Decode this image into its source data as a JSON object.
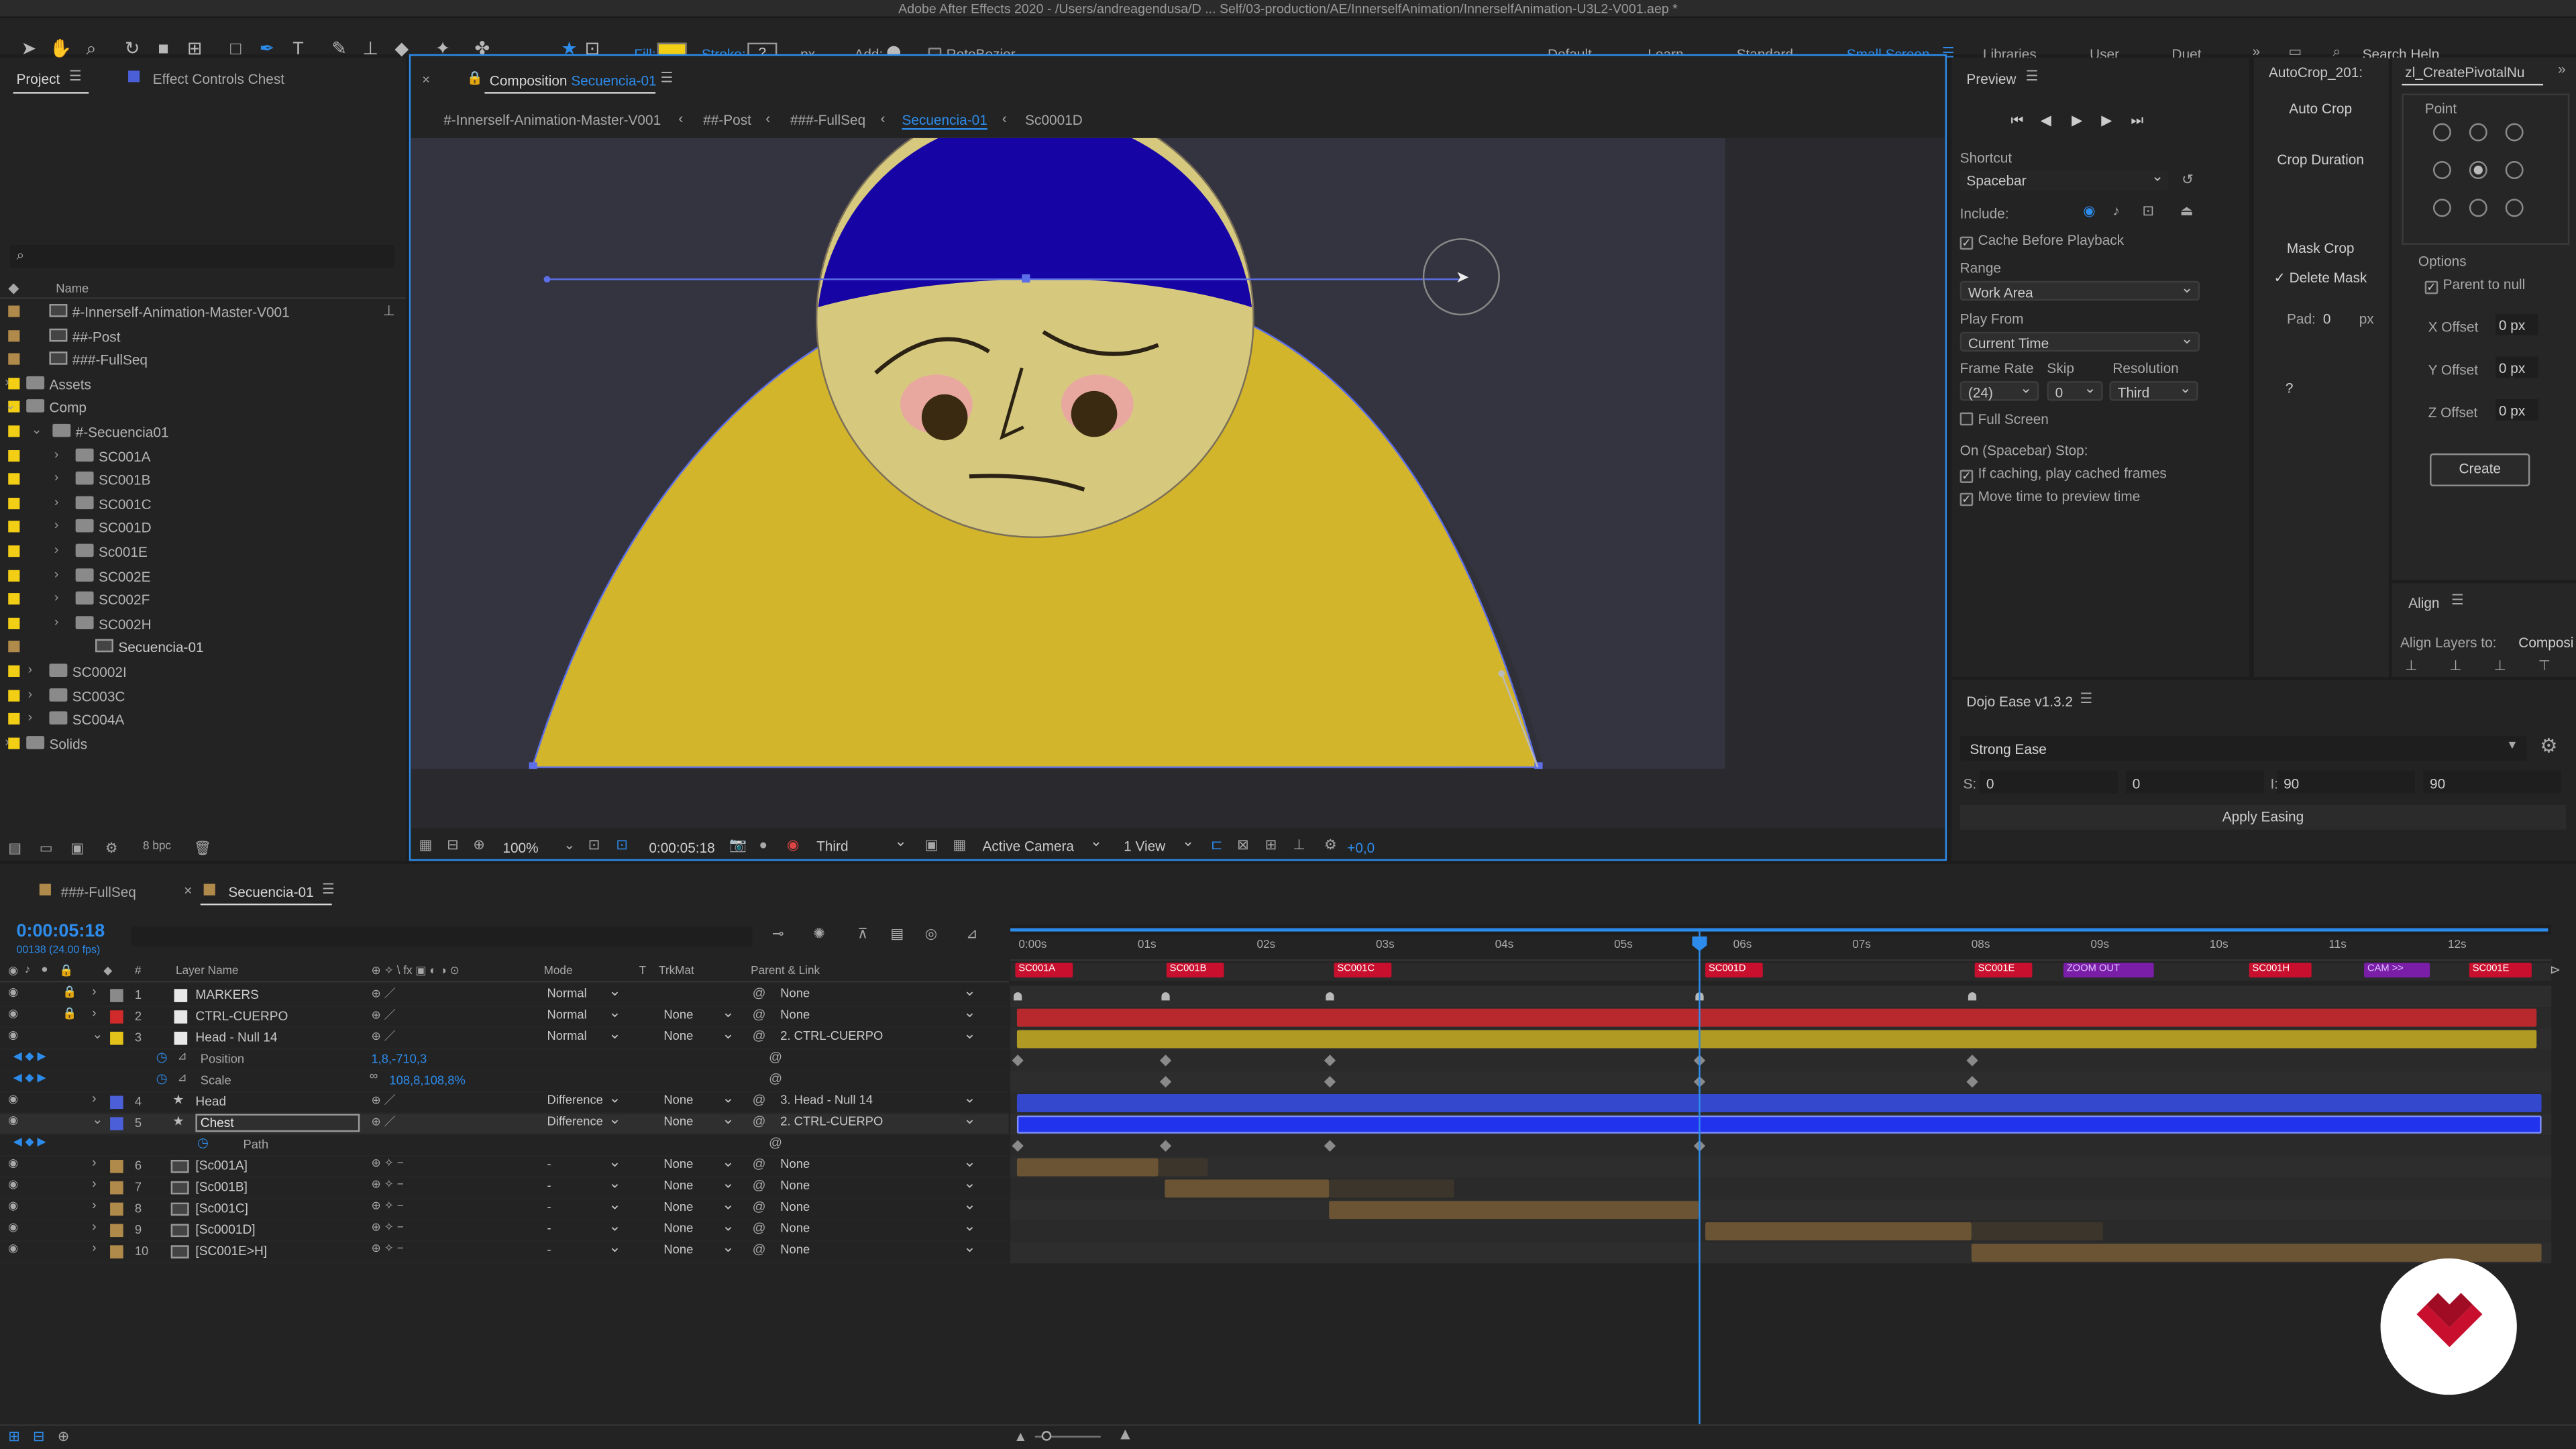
{
  "app": {
    "title": "Adobe After Effects 2020 - /Users/andreagendusa/D ... Self/03-production/AE/InnerselfAnimation/InnerselfAnimation-U3L2-V001.aep *"
  },
  "toolbar": {
    "fill_label": "Fill:",
    "stroke_label": "Stroke:",
    "stroke_value": "?",
    "px_label": "- px",
    "add_label": "Add:",
    "rotobezier_label": "RotoBezier",
    "fill_color": "#f2cf15"
  },
  "workspaces": [
    "Default",
    "Learn",
    "Standard",
    "Small Screen",
    "Libraries",
    "User",
    "Duet"
  ],
  "search": {
    "placeholder": "Search Help"
  },
  "project": {
    "tab_label": "Project",
    "effect_tab_label": "Effect Controls Chest",
    "name_header": "Name",
    "bpc": "8 bpc",
    "items": [
      {
        "label": "#-Innerself-Animation-Master-V001",
        "color": "#b08a4a",
        "icon": "composition-icon"
      },
      {
        "label": "##-Post",
        "color": "#b08a4a",
        "icon": "composition-icon"
      },
      {
        "label": "###-FullSeq",
        "color": "#b08a4a",
        "icon": "composition-icon"
      },
      {
        "label": "Assets",
        "color": "#f2cf15",
        "icon": "folder-icon"
      },
      {
        "label": "Comp",
        "color": "#f2cf15",
        "icon": "folder-icon"
      },
      {
        "label": "#-Secuencia01",
        "color": "#f2cf15",
        "icon": "folder-icon"
      },
      {
        "label": "SC001A",
        "color": "#f2cf15",
        "icon": "folder-icon"
      },
      {
        "label": "SC001B",
        "color": "#f2cf15",
        "icon": "folder-icon"
      },
      {
        "label": "SC001C",
        "color": "#f2cf15",
        "icon": "folder-icon"
      },
      {
        "label": "SC001D",
        "color": "#f2cf15",
        "icon": "folder-icon"
      },
      {
        "label": "Sc001E",
        "color": "#f2cf15",
        "icon": "folder-icon"
      },
      {
        "label": "SC002E",
        "color": "#f2cf15",
        "icon": "folder-icon"
      },
      {
        "label": "SC002F",
        "color": "#f2cf15",
        "icon": "folder-icon"
      },
      {
        "label": "SC002H",
        "color": "#f2cf15",
        "icon": "folder-icon"
      },
      {
        "label": "Secuencia-01",
        "color": "#b08a4a",
        "icon": "composition-icon"
      },
      {
        "label": "SC0002I",
        "color": "#f2cf15",
        "icon": "folder-icon"
      },
      {
        "label": "SC003C",
        "color": "#f2cf15",
        "icon": "folder-icon"
      },
      {
        "label": "SC004A",
        "color": "#f2cf15",
        "icon": "folder-icon"
      },
      {
        "label": "Solids",
        "color": "#f2cf15",
        "icon": "folder-icon"
      }
    ]
  },
  "composition": {
    "tab_prefix": "Composition",
    "tab_name": "Secuencia-01",
    "breadcrumbs": [
      "#-Innerself-Animation-Master-V001",
      "##-Post",
      "###-FullSeq",
      "Secuencia-01",
      "Sc0001D"
    ],
    "zoom": "100%",
    "timecode": "0:00:05:18",
    "resolution": "Third",
    "camera": "Active Camera",
    "views": "1 View",
    "exposure": "+0,0",
    "colors": {
      "body": "#d3b52c",
      "head": "#d6c97e",
      "hat": "#1704a4",
      "path": "#5d6fe8"
    }
  },
  "preview": {
    "title": "Preview",
    "shortcut_label": "Shortcut",
    "shortcut_value": "Spacebar",
    "include_label": "Include:",
    "cache_label": "Cache Before Playback",
    "range_label": "Range",
    "range_value": "Work Area",
    "playfrom_label": "Play From",
    "playfrom_value": "Current Time",
    "framerate_label": "Frame Rate",
    "skip_label": "Skip",
    "resolution_label": "Resolution",
    "framerate_value": "(24)",
    "skip_value": "0",
    "resolution_value": "Third",
    "fullscreen_label": "Full Screen",
    "stop_label": "On (Spacebar) Stop:",
    "stop_opt1": "If caching, play cached frames",
    "stop_opt2": "Move time to preview time"
  },
  "autocrop": {
    "title": "AutoCrop_201:",
    "auto_crop": "Auto Crop",
    "crop_duration": "Crop Duration",
    "mask_crop": "Mask Crop",
    "delete_mask": "Delete Mask",
    "pad_label": "Pad:",
    "pad_value": "0",
    "pad_unit": "px",
    "help": "?"
  },
  "pivotal": {
    "title": "zl_CreatePivotalNu",
    "point_label": "Point",
    "options_label": "Options",
    "parent_label": "Parent to null",
    "x_label": "X Offset",
    "y_label": "Y Offset",
    "z_label": "Z Offset",
    "x_value": "0 px",
    "y_value": "0 px",
    "z_value": "0 px",
    "create": "Create"
  },
  "align": {
    "title": "Align",
    "layers_to_label": "Align Layers to:",
    "layers_to_value": "Composi"
  },
  "dojo": {
    "title": "Dojo Ease v1.3.2",
    "preset": "Strong Ease",
    "s_label": "S:",
    "s_value": "0",
    "s_value2": "0",
    "l_label": "I:",
    "l_value": "90",
    "l_value2": "90",
    "apply": "Apply Easing"
  },
  "timeline": {
    "tab1": "###-FullSeq",
    "tab2": "Secuencia-01",
    "timecode": "0:00:05:18",
    "frame_info": "00138 (24.00 fps)",
    "headers": {
      "num": "#",
      "layer_name": "Layer Name",
      "mode": "Mode",
      "t": "T",
      "trkmat": "TrkMat",
      "parent": "Parent & Link"
    },
    "ruler": [
      "0:00s",
      "01s",
      "02s",
      "03s",
      "04s",
      "05s",
      "06s",
      "07s",
      "08s",
      "09s",
      "10s",
      "11s",
      "12s"
    ],
    "markers": [
      "SC001A",
      "SC001B",
      "SC001C",
      "SC001D",
      "SC001E",
      "ZOOM OUT",
      "SC001H",
      "CAM >>",
      "SC001E"
    ],
    "layers": [
      {
        "num": "1",
        "name": "MARKERS",
        "color": "#8a8a8a",
        "mode": "Normal",
        "trk": "",
        "parent": "None"
      },
      {
        "num": "2",
        "name": "CTRL-CUERPO",
        "color": "#d12a2a",
        "mode": "Normal",
        "trk": "None",
        "parent": "None"
      },
      {
        "num": "3",
        "name": "Head - Null 14",
        "color": "#e3c21a",
        "mode": "Normal",
        "trk": "None",
        "parent": "2. CTRL-CUERPO"
      },
      {
        "num": "",
        "name": "Position",
        "value": "1,8,-710,3"
      },
      {
        "num": "",
        "name": "Scale",
        "value": "108,8,108,8%"
      },
      {
        "num": "4",
        "name": "Head",
        "color": "#4a5fd8",
        "mode": "Difference",
        "trk": "None",
        "parent": "3. Head - Null 14"
      },
      {
        "num": "5",
        "name": "Chest",
        "color": "#4a5fd8",
        "mode": "Difference",
        "trk": "None",
        "parent": "2. CTRL-CUERPO"
      },
      {
        "num": "",
        "name": "Path",
        "value": ""
      },
      {
        "num": "6",
        "name": "[Sc001A]",
        "color": "#b08a4a",
        "mode": "-",
        "trk": "None",
        "parent": "None"
      },
      {
        "num": "7",
        "name": "[Sc001B]",
        "color": "#b08a4a",
        "mode": "-",
        "trk": "None",
        "parent": "None"
      },
      {
        "num": "8",
        "name": "[Sc001C]",
        "color": "#b08a4a",
        "mode": "-",
        "trk": "None",
        "parent": "None"
      },
      {
        "num": "9",
        "name": "[Sc0001D]",
        "color": "#b08a4a",
        "mode": "-",
        "trk": "None",
        "parent": "None"
      },
      {
        "num": "10",
        "name": "[SC001E>H]",
        "color": "#b08a4a",
        "mode": "-",
        "trk": "None",
        "parent": "None"
      }
    ]
  },
  "colors": {
    "accent": "#2d8ceb",
    "marker_red": "#c8102e",
    "badge_red": "#c8102e"
  }
}
